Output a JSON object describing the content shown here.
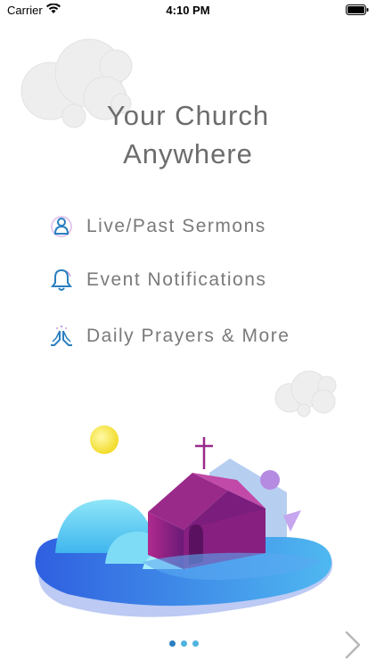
{
  "status_bar": {
    "carrier": "Carrier",
    "time": "4:10 PM"
  },
  "onboarding": {
    "title_line1": "Your Church",
    "title_line2": "Anywhere",
    "features": [
      {
        "label": "Live/Past Sermons",
        "icon": "person-icon"
      },
      {
        "label": "Event Notifications",
        "icon": "bell-icon"
      },
      {
        "label": "Daily Prayers & More",
        "icon": "praying-hands-icon"
      }
    ],
    "pager": {
      "count": 3,
      "active_index": 0
    },
    "next_icon": "chevron-right-icon"
  },
  "colors": {
    "accent_blue": "#2a7fc0",
    "church_purple": "#8a1f7a",
    "sun_yellow": "#f4e23a"
  }
}
